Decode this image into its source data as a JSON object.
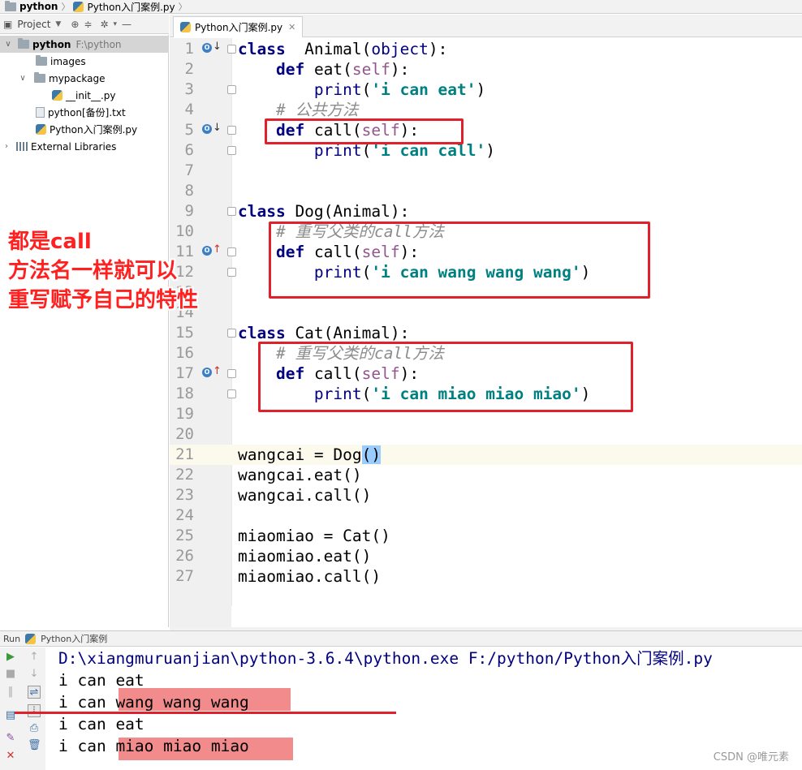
{
  "navbar": {
    "project": "python",
    "file": "Python入门案例.py"
  },
  "project_panel": {
    "title": "Project",
    "tree": [
      {
        "label": "python",
        "extra": "F:\\python",
        "kind": "folder",
        "depth": 0,
        "expanded": true,
        "selected": true
      },
      {
        "label": "images",
        "kind": "folder",
        "depth": 1
      },
      {
        "label": "mypackage",
        "kind": "folder",
        "depth": 1,
        "expanded": true
      },
      {
        "label": "__init__.py",
        "kind": "py",
        "depth": 2
      },
      {
        "label": "python[备份].txt",
        "kind": "file",
        "depth": 1
      },
      {
        "label": "Python入门案例.py",
        "kind": "py",
        "depth": 1
      },
      {
        "label": "External Libraries",
        "kind": "lib",
        "depth": 0,
        "collapsed": true
      }
    ]
  },
  "annotation": {
    "line1": "都是call",
    "line2": "方法名一样就可以",
    "line3": "重写赋予自己的特性"
  },
  "editor": {
    "tab": "Python入门案例.py",
    "current_line": 21,
    "lines": [
      {
        "n": "1",
        "tokens": [
          [
            "kw",
            "class"
          ],
          [
            "",
            "  Animal("
          ],
          [
            "bi",
            "object"
          ],
          [
            "",
            "):"
          ]
        ]
      },
      {
        "n": "2",
        "tokens": [
          [
            "",
            "    "
          ],
          [
            "kw",
            "def"
          ],
          [
            "",
            " eat("
          ],
          [
            "sf",
            "self"
          ],
          [
            "",
            "):"
          ]
        ]
      },
      {
        "n": "3",
        "tokens": [
          [
            "",
            "        "
          ],
          [
            "bi",
            "print"
          ],
          [
            "",
            "("
          ],
          [
            "st",
            "'i can eat'"
          ],
          [
            "",
            ")"
          ]
        ]
      },
      {
        "n": "4",
        "tokens": [
          [
            "",
            "    "
          ],
          [
            "cm",
            "# 公共方法"
          ]
        ]
      },
      {
        "n": "5",
        "tokens": [
          [
            "",
            "    "
          ],
          [
            "kw",
            "def"
          ],
          [
            "",
            " call("
          ],
          [
            "sf",
            "self"
          ],
          [
            "",
            "):"
          ]
        ]
      },
      {
        "n": "6",
        "tokens": [
          [
            "",
            "        "
          ],
          [
            "bi",
            "print"
          ],
          [
            "",
            "("
          ],
          [
            "st",
            "'i can call'"
          ],
          [
            "",
            ")"
          ]
        ]
      },
      {
        "n": "7",
        "tokens": []
      },
      {
        "n": "8",
        "tokens": []
      },
      {
        "n": "9",
        "tokens": [
          [
            "kw",
            "class"
          ],
          [
            "",
            " Dog(Animal):"
          ]
        ]
      },
      {
        "n": "10",
        "tokens": [
          [
            "",
            "    "
          ],
          [
            "cm",
            "# 重写父类的call方法"
          ]
        ]
      },
      {
        "n": "11",
        "tokens": [
          [
            "",
            "    "
          ],
          [
            "kw",
            "def"
          ],
          [
            "",
            " call("
          ],
          [
            "sf",
            "self"
          ],
          [
            "",
            "):"
          ]
        ]
      },
      {
        "n": "12",
        "tokens": [
          [
            "",
            "        "
          ],
          [
            "bi",
            "print"
          ],
          [
            "",
            "("
          ],
          [
            "st",
            "'i can wang wang wang'"
          ],
          [
            "",
            ")"
          ]
        ]
      },
      {
        "n": "13",
        "tokens": []
      },
      {
        "n": "14",
        "tokens": []
      },
      {
        "n": "15",
        "tokens": [
          [
            "kw",
            "class"
          ],
          [
            "",
            " Cat(Animal):"
          ]
        ]
      },
      {
        "n": "16",
        "tokens": [
          [
            "",
            "    "
          ],
          [
            "cm",
            "# 重写父类的call方法"
          ]
        ]
      },
      {
        "n": "17",
        "tokens": [
          [
            "",
            "    "
          ],
          [
            "kw",
            "def"
          ],
          [
            "",
            " call("
          ],
          [
            "sf",
            "self"
          ],
          [
            "",
            "):"
          ]
        ]
      },
      {
        "n": "18",
        "tokens": [
          [
            "",
            "        "
          ],
          [
            "bi",
            "print"
          ],
          [
            "",
            "("
          ],
          [
            "st",
            "'i can miao miao miao'"
          ],
          [
            "",
            ")"
          ]
        ]
      },
      {
        "n": "19",
        "tokens": []
      },
      {
        "n": "20",
        "tokens": []
      },
      {
        "n": "21",
        "tokens": [
          [
            "",
            "wangcai = Dog"
          ],
          [
            "paren-hl",
            "()"
          ]
        ]
      },
      {
        "n": "22",
        "tokens": [
          [
            "",
            "wangcai.eat()"
          ]
        ]
      },
      {
        "n": "23",
        "tokens": [
          [
            "",
            "wangcai.call()"
          ]
        ]
      },
      {
        "n": "24",
        "tokens": []
      },
      {
        "n": "25",
        "tokens": [
          [
            "",
            "miaomiao = Cat()"
          ]
        ]
      },
      {
        "n": "26",
        "tokens": [
          [
            "",
            "miaomiao.eat()"
          ]
        ]
      },
      {
        "n": "27",
        "tokens": [
          [
            "",
            "miaomiao.call()"
          ]
        ]
      }
    ]
  },
  "run_panel": {
    "label": "Run",
    "config": "Python入门案例",
    "output": [
      "D:\\xiangmuruanjian\\python-3.6.4\\python.exe F:/python/Python入门案例.py",
      "i can eat",
      "i can wang wang wang",
      "i can eat",
      "i can miao miao miao"
    ]
  },
  "watermark": "CSDN @唯元素",
  "colors": {
    "annotation": "#ff2020",
    "highlight_box": "#e0202a",
    "output_highlight": "#f28c8c",
    "keyword": "#000080",
    "string": "#008080"
  }
}
